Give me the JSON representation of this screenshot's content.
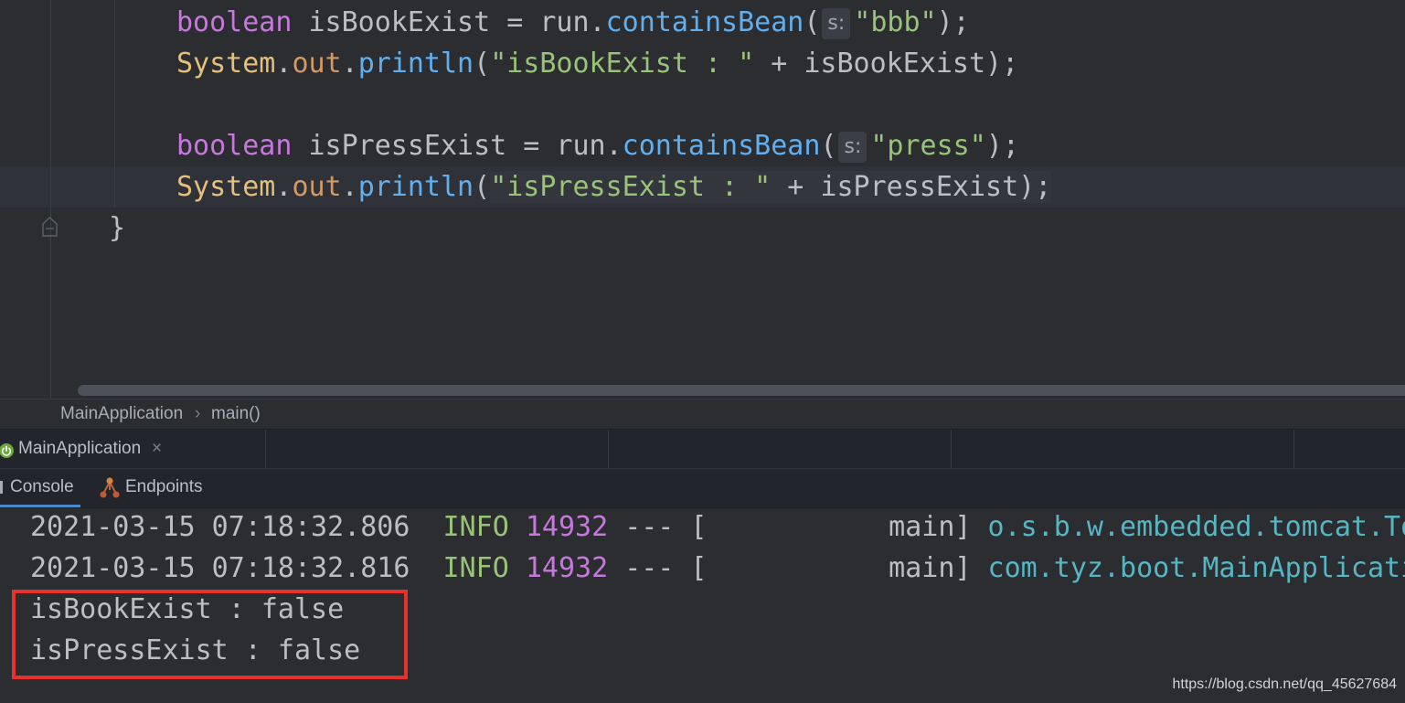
{
  "colors": {
    "editor_background": "#2b2d31",
    "panel_background": "#22252b",
    "default_text": "#bcbec4",
    "keyword": "#c678dd",
    "method_call": "#61afef",
    "string_literal": "#98c379",
    "class_name": "#e5c07b",
    "static_field": "#d19a66",
    "log_level_info": "#98c379",
    "log_pid": "#c678dd",
    "log_logger": "#56b6c2",
    "active_tab_underline": "#4a88c7",
    "highlight_box_border": "#e8302c"
  },
  "editor": {
    "lines": [
      {
        "keyword": "boolean",
        "text": " isBookExist = run.",
        "method": "containsBean",
        "open_paren": "(",
        "param_hint": "s:",
        "string": "\"bbb\"",
        "close": ");"
      },
      {
        "class_name": "System",
        "dot1": ".",
        "field": "out",
        "dot2": ".",
        "method": "println",
        "open_paren": "(",
        "string": "\"isBookExist : \"",
        "rest": " + isBookExist);"
      },
      {
        "keyword": "boolean",
        "text": " isPressExist = run.",
        "method": "containsBean",
        "open_paren": "(",
        "param_hint": "s:",
        "string": "\"press\"",
        "close": ");"
      },
      {
        "class_name": "System",
        "dot1": ".",
        "field": "out",
        "dot2": ".",
        "method": "println",
        "open_paren": "(",
        "string": "\"isPressExist : \"",
        "rest": " + isPressExist);"
      },
      {
        "text": "}"
      }
    ]
  },
  "breadcrumb": {
    "items": [
      "MainApplication",
      "main()"
    ],
    "separator": "›"
  },
  "run_tabs": [
    {
      "label": "MainApplication",
      "close_glyph": "×",
      "icon": "spring-boot-icon"
    }
  ],
  "console_tabs": [
    {
      "label": "Console",
      "icon": "console-icon"
    },
    {
      "label": "Endpoints",
      "icon": "endpoints-icon"
    }
  ],
  "console": {
    "log_lines": [
      {
        "timestamp": "2021-03-15 07:18:32.806",
        "level": "INFO",
        "pid": "14932",
        "thread": "--- [           main]",
        "logger": "o.s.b.w.embedded.tomcat.To"
      },
      {
        "timestamp": "2021-03-15 07:18:32.816",
        "level": "INFO",
        "pid": "14932",
        "thread": "--- [           main]",
        "logger": "com.tyz.boot.MainApplicati"
      }
    ],
    "output_lines": [
      "isBookExist : false",
      "isPressExist : false"
    ]
  },
  "watermark": "https://blog.csdn.net/qq_45627684"
}
